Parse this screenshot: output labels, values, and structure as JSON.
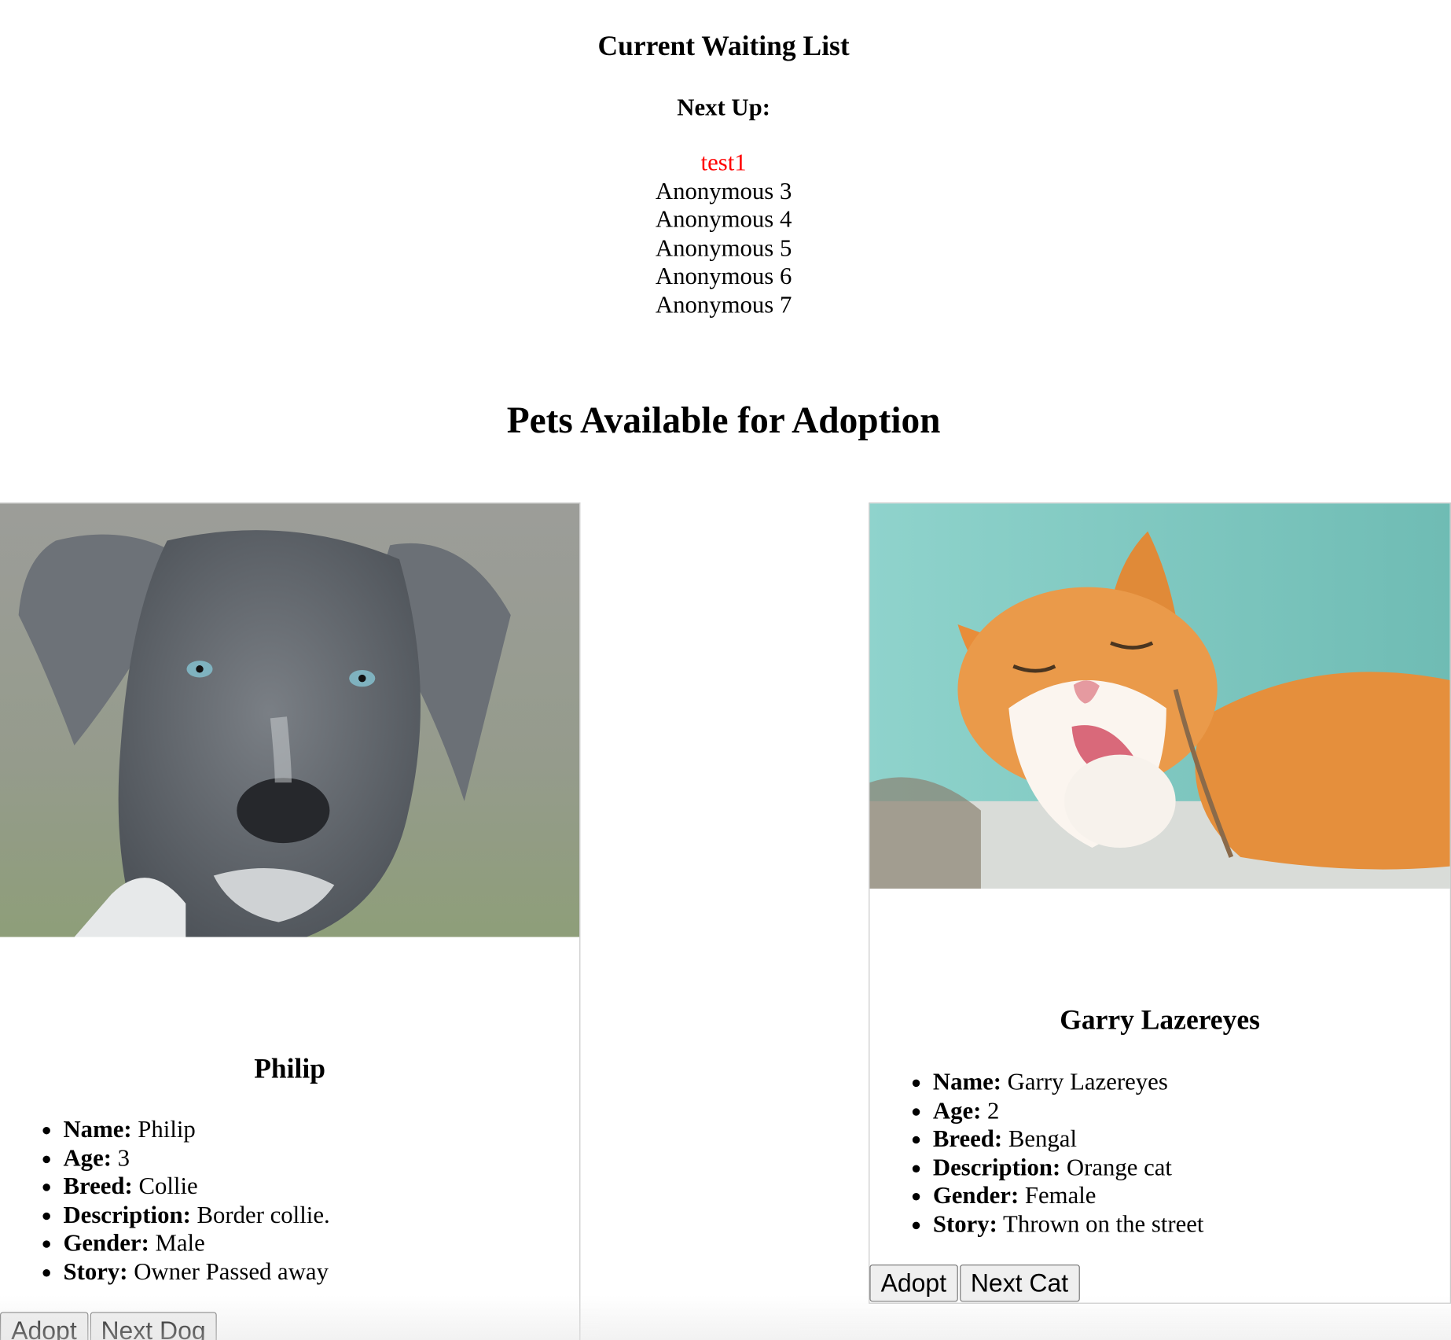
{
  "waiting_list": {
    "title": "Current Waiting List",
    "next_up_label": "Next Up:",
    "queue": [
      "test1",
      "Anonymous 3",
      "Anonymous 4",
      "Anonymous 5",
      "Anonymous 6",
      "Anonymous 7"
    ]
  },
  "pets": {
    "title": "Pets Available for Adoption",
    "dog": {
      "heading": "Philip",
      "image_alt": "gray-puppy-photo",
      "facts": [
        {
          "label": "Name:",
          "value": "Philip"
        },
        {
          "label": "Age:",
          "value": "3"
        },
        {
          "label": "Breed:",
          "value": "Collie"
        },
        {
          "label": "Description:",
          "value": "Border collie."
        },
        {
          "label": "Gender:",
          "value": "Male"
        },
        {
          "label": "Story:",
          "value": "Owner Passed away"
        }
      ],
      "adopt_label": "Adopt",
      "next_label": "Next Dog"
    },
    "cat": {
      "heading": "Garry Lazereyes",
      "image_alt": "orange-cat-photo",
      "facts": [
        {
          "label": "Name:",
          "value": "Garry Lazereyes"
        },
        {
          "label": "Age:",
          "value": "2"
        },
        {
          "label": "Breed:",
          "value": "Bengal"
        },
        {
          "label": "Description:",
          "value": "Orange cat"
        },
        {
          "label": "Gender:",
          "value": "Female"
        },
        {
          "label": "Story:",
          "value": "Thrown on the street"
        }
      ],
      "adopt_label": "Adopt",
      "next_label": "Next Cat"
    }
  },
  "colors": {
    "current_in_queue": "#ff0000"
  }
}
